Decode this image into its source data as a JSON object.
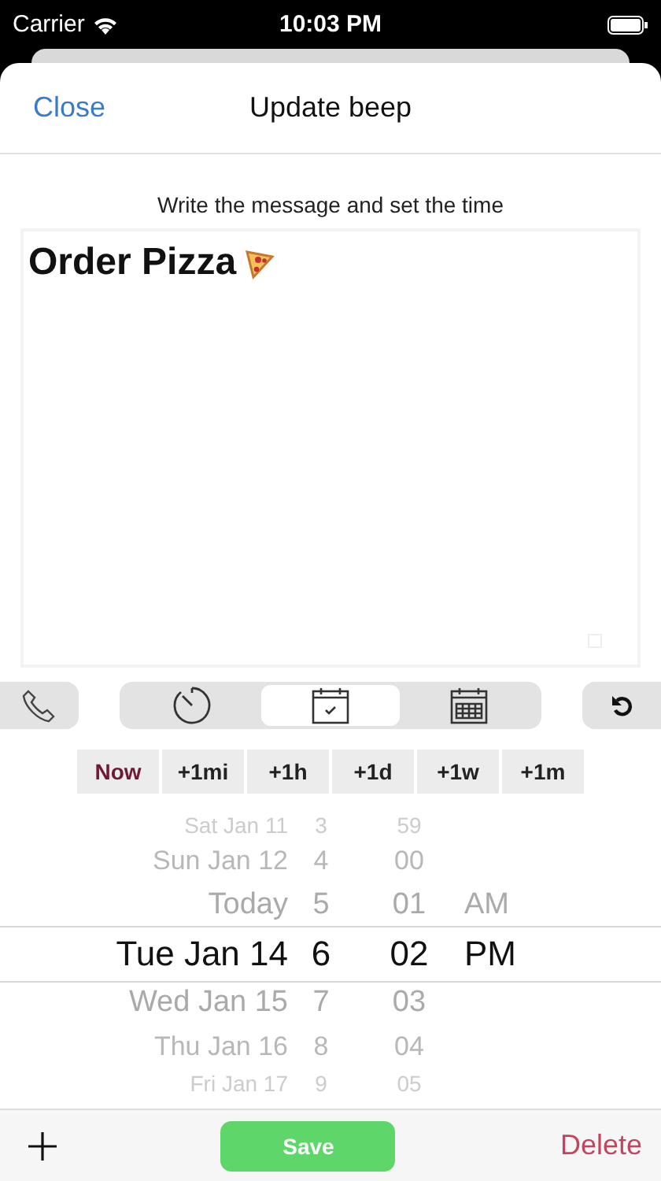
{
  "status_bar": {
    "carrier": "Carrier",
    "time": "10:03 PM"
  },
  "header": {
    "close": "Close",
    "title": "Update beep"
  },
  "hint": "Write the message and set the time",
  "message": {
    "value": "Order Pizza"
  },
  "modes": [
    {
      "kind": "timer",
      "selected": false
    },
    {
      "kind": "date",
      "selected": true
    },
    {
      "kind": "calendar",
      "selected": false
    }
  ],
  "quick": [
    {
      "label": "Now",
      "selected": true
    },
    {
      "label": "+1mi",
      "selected": false
    },
    {
      "label": "+1h",
      "selected": false
    },
    {
      "label": "+1d",
      "selected": false
    },
    {
      "label": "+1w",
      "selected": false
    },
    {
      "label": "+1m",
      "selected": false
    }
  ],
  "picker": {
    "rows": [
      {
        "date": "Sat Jan 11",
        "hour": "3",
        "minute": "59",
        "selected": false
      },
      {
        "date": "Sun Jan 12",
        "hour": "4",
        "minute": "00",
        "selected": false
      },
      {
        "date": "Today",
        "hour": "5",
        "minute": "01",
        "period": "AM",
        "selected": false
      },
      {
        "date": "Tue Jan 14",
        "hour": "6",
        "minute": "02",
        "period": "PM",
        "selected": true
      },
      {
        "date": "Wed Jan 15",
        "hour": "7",
        "minute": "03",
        "selected": false
      },
      {
        "date": "Thu Jan 16",
        "hour": "8",
        "minute": "04",
        "selected": false
      },
      {
        "date": "Fri Jan 17",
        "hour": "9",
        "minute": "05",
        "selected": false
      }
    ]
  },
  "toolbar": {
    "save": "Save",
    "delete": "Delete"
  }
}
